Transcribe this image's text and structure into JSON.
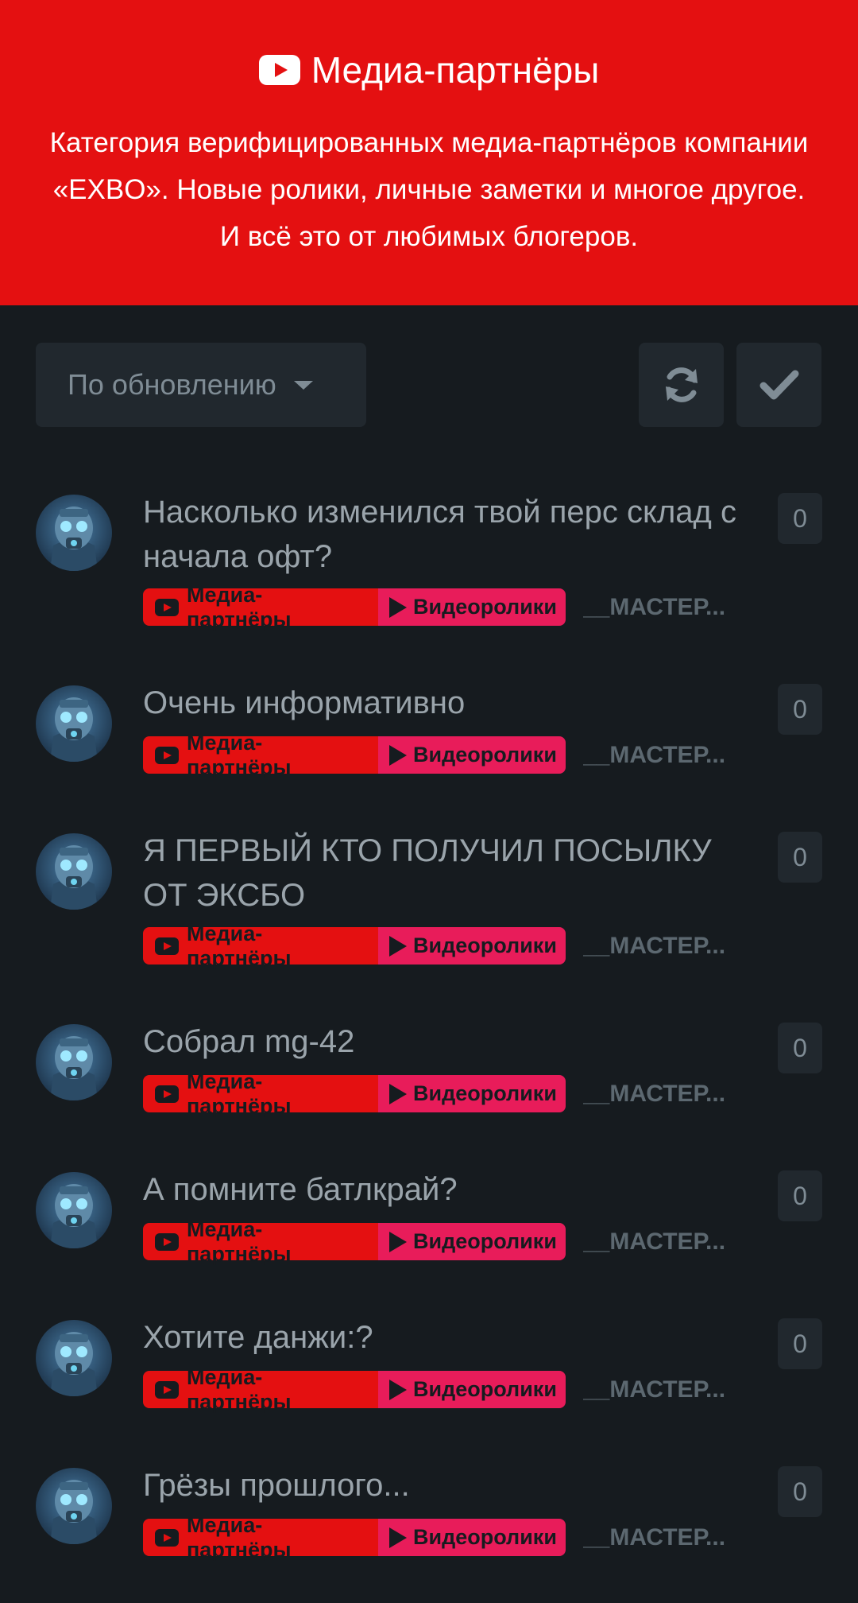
{
  "header": {
    "title": "Медиа-партнёры",
    "description": "Категория верифицированных медиа-партнёров компании «EXBO». Новые ролики, личные заметки и многое другое. И всё это от любимых блогеров."
  },
  "toolbar": {
    "sort_label": "По обновлению",
    "refresh_icon": "refresh-icon",
    "mark_read_icon": "check-icon"
  },
  "colors": {
    "accent_red": "#e41011",
    "tag_pink": "#e81c5a",
    "background": "#161b1f",
    "panel": "#21282e"
  },
  "topics": [
    {
      "title": "Насколько изменился твой перс склад с начала офт?",
      "tag_primary": "Медиа-партнёры",
      "tag_secondary": "Видеоролики",
      "author": "__МАСТЕР...",
      "replies": "0"
    },
    {
      "title": "Очень информативно",
      "tag_primary": "Медиа-партнёры",
      "tag_secondary": "Видеоролики",
      "author": "__МАСТЕР...",
      "replies": "0"
    },
    {
      "title": "Я ПЕРВЫЙ КТО ПОЛУЧИЛ ПОСЫЛКУ ОТ ЭКСБО",
      "tag_primary": "Медиа-партнёры",
      "tag_secondary": "Видеоролики",
      "author": "__МАСТЕР...",
      "replies": "0"
    },
    {
      "title": "Собрал mg-42",
      "tag_primary": "Медиа-партнёры",
      "tag_secondary": "Видеоролики",
      "author": "__МАСТЕР...",
      "replies": "0"
    },
    {
      "title": "А помните батлкрай?",
      "tag_primary": "Медиа-партнёры",
      "tag_secondary": "Видеоролики",
      "author": "__МАСТЕР...",
      "replies": "0"
    },
    {
      "title": "Хотите данжи:?",
      "tag_primary": "Медиа-партнёры",
      "tag_secondary": "Видеоролики",
      "author": "__МАСТЕР...",
      "replies": "0"
    },
    {
      "title": "Грёзы прошлого...",
      "tag_primary": "Медиа-партнёры",
      "tag_secondary": "Видеоролики",
      "author": "__МАСТЕР...",
      "replies": "0"
    }
  ]
}
